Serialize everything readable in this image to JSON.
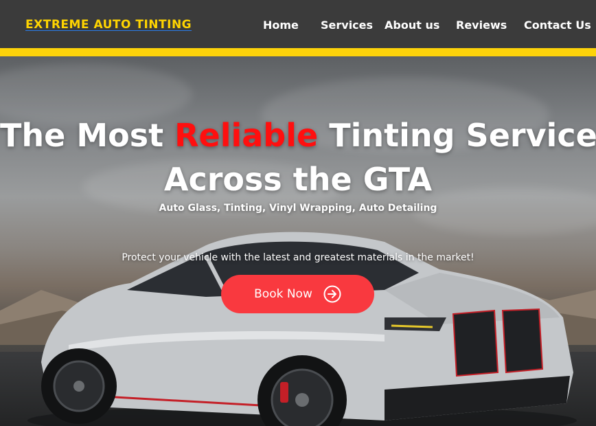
{
  "brand": {
    "name": "EXTREME AUTO TINTING"
  },
  "nav": {
    "items": [
      {
        "label": "Home"
      },
      {
        "label": "Services"
      },
      {
        "label": "About us"
      },
      {
        "label": "Reviews"
      },
      {
        "label": "Contact Us"
      }
    ]
  },
  "hero": {
    "headline_part1": "The Most ",
    "headline_accent": "Reliable",
    "headline_part2": " Tinting Service",
    "headline_line2": "Across the GTA",
    "services_line": "Auto Glass, Tinting, Vinyl Wrapping, Auto Detailing",
    "tagline": "Protect your vehicle with the latest and greatest materials in the market!",
    "cta_label": "Book Now",
    "cta_icon": "arrow-right-circle-icon"
  },
  "colors": {
    "nav_bg": "#3b3b3b",
    "brand_yellow": "#ffd400",
    "accent_bar": "#fdd30a",
    "accent_red": "#ff0f0f",
    "cta_bg": "#f9393f"
  }
}
